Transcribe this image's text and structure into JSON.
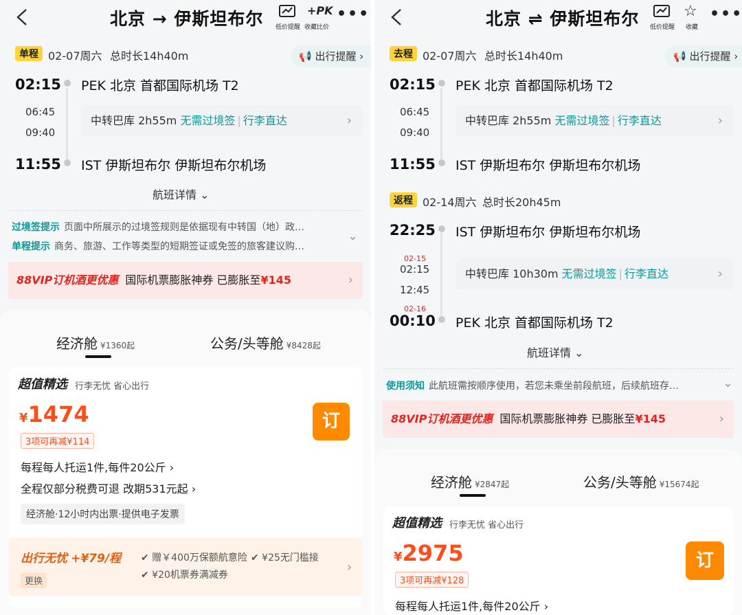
{
  "left": {
    "header": {
      "title": "北京 → 伊斯坦布尔",
      "lowprice_label": "低价提醒",
      "pk_text": "+PK",
      "pk_label": "收藏比价"
    },
    "trip": {
      "badge": "单程",
      "date": "02-07周六",
      "duration": "总时长14h40m",
      "reminder": "出行提醒",
      "dep_time": "02:15",
      "dep_airport": "PEK 北京 首都国际机场 T2",
      "mid_arr": "06:45",
      "mid_dep": "09:40",
      "transfer": "中转巴库 2h55m",
      "visa": "无需过境签",
      "luggage": "行李直达",
      "arr_time": "11:55",
      "arr_airport": "IST 伊斯坦布尔 伊斯坦布尔机场"
    },
    "details": "航班详情",
    "tips": [
      {
        "label": "过境签提示",
        "text": "页面中所展示的过境签规则是依据现有中转国（地）政…"
      },
      {
        "label": "单程提示",
        "text": "商务、旅游、工作等类型的短期签证或免签的旅客建议购…"
      }
    ],
    "promo": {
      "vip": "88VIP订机酒更优惠",
      "text": "国际机票膨胀神券 已膨胀至",
      "price": "¥145"
    },
    "tabs": {
      "economy": "经济舱",
      "economy_price": "¥1360起",
      "business": "公务/头等舱",
      "business_price": "¥8428起"
    },
    "card": {
      "title": "超值精选",
      "subtitle": "行李无忧 省心出行",
      "currency": "¥",
      "price": "1474",
      "reduce": "3项可再减¥114",
      "book": "订",
      "baggage": "每程每人托运1件,每件20公斤",
      "refund": "全程仅部分税费可退 改期531元起",
      "pill": "经济舱·12小时内出票·提供电子发票"
    },
    "worry": {
      "title": "出行无忧",
      "price": "+¥79/程",
      "change": "更换",
      "item1": "✔ 赠￥400万保额航意险",
      "item2": "✔ ¥25无门槛接",
      "item3": "✔ ¥20机票券满减券"
    }
  },
  "right": {
    "header": {
      "title": "北京 ⇌ 伊斯坦布尔",
      "lowprice_label": "低价提醒",
      "fav_label": "收藏"
    },
    "outbound": {
      "badge": "去程",
      "date": "02-07周六",
      "duration": "总时长14h40m",
      "reminder": "出行提醒",
      "dep_time": "02:15",
      "dep_airport": "PEK 北京 首都国际机场 T2",
      "mid_arr": "06:45",
      "mid_dep": "09:40",
      "transfer": "中转巴库 2h55m",
      "visa": "无需过境签",
      "luggage": "行李直达",
      "arr_time": "11:55",
      "arr_airport": "IST 伊斯坦布尔 伊斯坦布尔机场"
    },
    "return": {
      "badge": "返程",
      "date": "02-14周六",
      "duration": "总时长20h45m",
      "dep_time": "22:25",
      "dep_airport": "IST 伊斯坦布尔 伊斯坦布尔机场",
      "mid_date1": "02-15",
      "mid_arr": "02:15",
      "mid_dep": "12:45",
      "transfer": "中转巴库 10h30m",
      "visa": "无需过境签",
      "luggage": "行李直达",
      "arr_date": "02-16",
      "arr_time": "00:10",
      "arr_airport": "PEK 北京 首都国际机场 T2"
    },
    "details": "航班详情",
    "tip": {
      "label": "使用须知",
      "text": "此航班需按顺序使用，若您未乘坐前段航班，后续航班存…"
    },
    "promo": {
      "vip": "88VIP订机酒更优惠",
      "text": "国际机票膨胀神券 已膨胀至",
      "price": "¥145"
    },
    "tabs": {
      "economy": "经济舱",
      "economy_price": "¥2847起",
      "business": "公务/头等舱",
      "business_price": "¥15674起"
    },
    "card": {
      "title": "超值精选",
      "subtitle": "行李无忧 省心出行",
      "currency": "¥",
      "price": "2975",
      "reduce": "3项可再减¥128",
      "book": "订",
      "baggage": "每程每人托运1件,每件20公斤"
    }
  }
}
